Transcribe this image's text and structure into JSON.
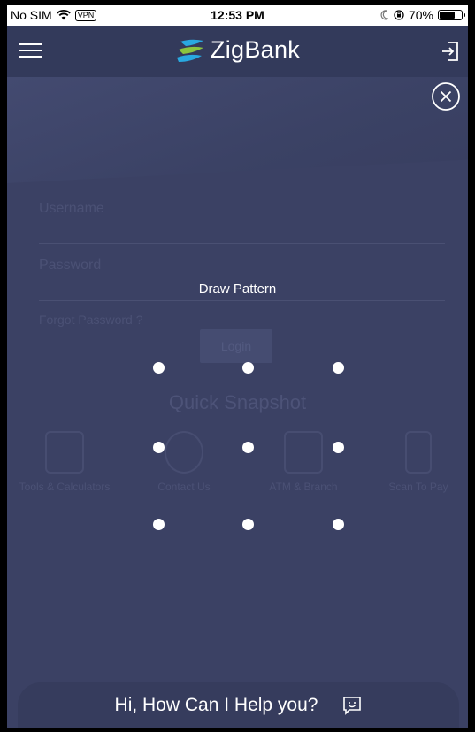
{
  "status_bar": {
    "carrier": "No SIM",
    "vpn": "VPN",
    "time": "12:53 PM",
    "battery": "70%",
    "battery_level": 0.7
  },
  "header": {
    "brand": "ZigBank"
  },
  "login_form": {
    "username_label": "Username",
    "password_label": "Password",
    "forgot_label": "Forgot Password ?",
    "login_button": "Login"
  },
  "quick_snapshot": {
    "title": "Quick Snapshot",
    "items": [
      {
        "label": "Tools & Calculators"
      },
      {
        "label": "Contact Us"
      },
      {
        "label": "ATM & Branch"
      },
      {
        "label": "Scan To Pay"
      }
    ]
  },
  "pattern": {
    "title": "Draw Pattern",
    "rows": 3,
    "cols": 3
  },
  "chat": {
    "text": "Hi, How Can I Help you?"
  },
  "colors": {
    "overlay_bg": "#3a4062",
    "header_bg": "#333a5b",
    "dot": "#ffffff",
    "logo_blue": "#29a9e1",
    "logo_green": "#8bc53f"
  }
}
